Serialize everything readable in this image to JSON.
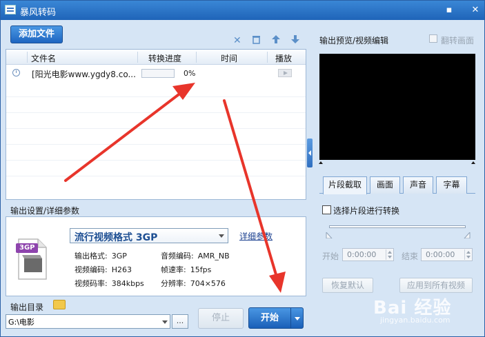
{
  "window": {
    "title": "暴风转码",
    "minimize": "▪",
    "close": "✕"
  },
  "toolbar": {
    "add_file": "添加文件",
    "remove": "✕",
    "delete": "🗑",
    "up": "▲",
    "down": "▼"
  },
  "file_list": {
    "columns": [
      "文件名",
      "转换进度",
      "时间",
      "播放"
    ],
    "rows": [
      {
        "name": "[阳光电影www.ygdy8.co...",
        "progress_text": "0%",
        "progress": 0,
        "time": ""
      }
    ]
  },
  "output_settings": {
    "label": "输出设置/详细参数",
    "format": "流行视频格式  3GP",
    "detail_link": "详细参数",
    "icon_label": "3GP",
    "params": [
      {
        "k": "输出格式:",
        "v": "3GP"
      },
      {
        "k": "音频编码:",
        "v": "AMR_NB"
      },
      {
        "k": "视频编码:",
        "v": "H263"
      },
      {
        "k": "帧速率:",
        "v": "15fps"
      },
      {
        "k": "视频码率:",
        "v": "384kbps"
      },
      {
        "k": "分辨率:",
        "v": "704×576"
      }
    ]
  },
  "output_dir": {
    "label": "输出目录",
    "value": "G:\\电影",
    "browse": "..."
  },
  "actions": {
    "stop": "停止",
    "start": "开始"
  },
  "preview": {
    "label": "输出预览/视频编辑",
    "flip_label": "翻转画面"
  },
  "tabs": [
    "片段截取",
    "画面",
    "声音",
    "字幕"
  ],
  "clip": {
    "checkbox_label": "选择片段进行转换",
    "start_label": "开始",
    "start_time": "0:00:00",
    "end_label": "结束",
    "end_time": "0:00:00",
    "reset": "恢复默认",
    "apply_all": "应用到所有视频"
  },
  "watermark": {
    "brand": "Bai 经验",
    "url": "jingyan.baidu.com"
  },
  "colors": {
    "accent": "#1e66c1",
    "annotation_arrow": "#e8352b"
  }
}
